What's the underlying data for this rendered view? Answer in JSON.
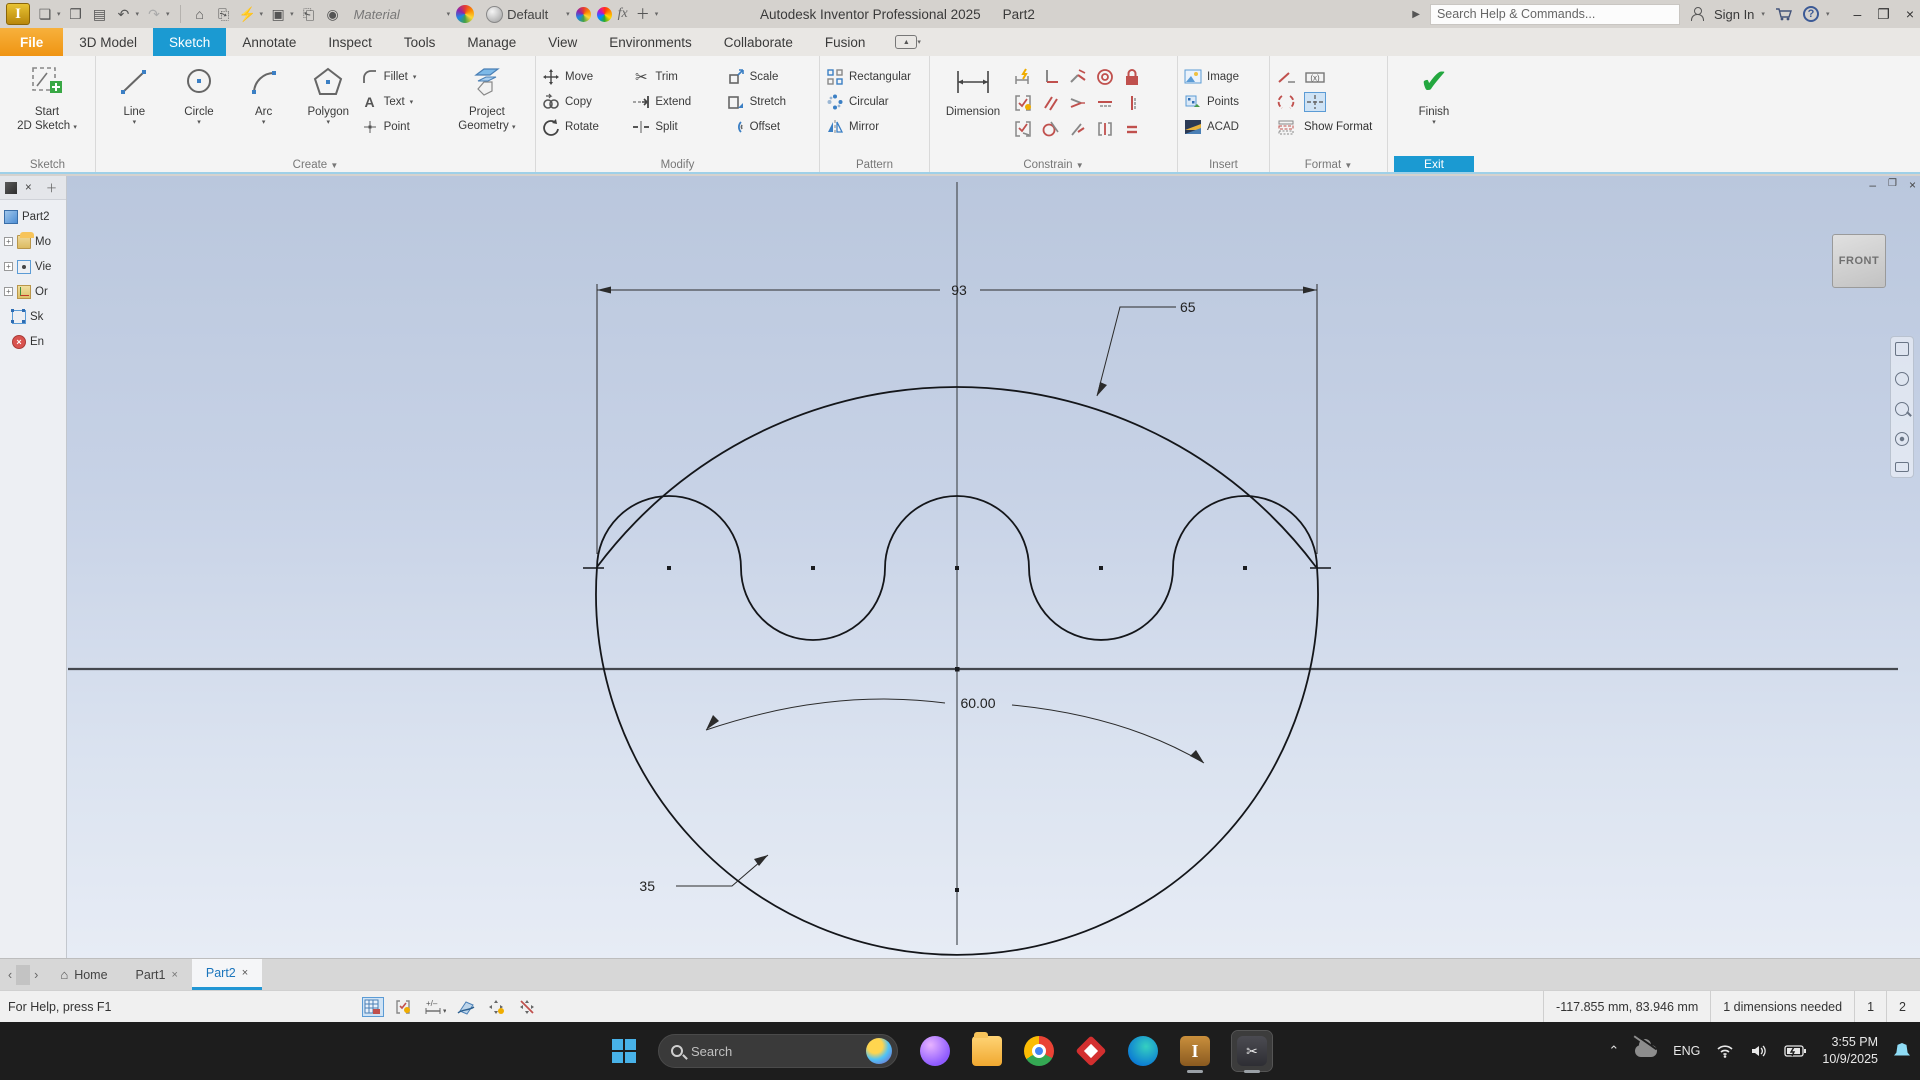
{
  "titlebar": {
    "app_initial": "I",
    "material_label": "Material",
    "appearance_label": "Default",
    "fx_label": "fx",
    "title": "Autodesk Inventor Professional 2025",
    "document": "Part2",
    "search_placeholder": "Search Help & Commands...",
    "sign_in_label": "Sign In",
    "help_glyph": "?",
    "minimize_glyph": "–",
    "restore_glyph": "❐",
    "close_glyph": "×"
  },
  "tabs": {
    "items": [
      {
        "label": "File"
      },
      {
        "label": "3D Model"
      },
      {
        "label": "Sketch"
      },
      {
        "label": "Annotate"
      },
      {
        "label": "Inspect"
      },
      {
        "label": "Tools"
      },
      {
        "label": "Manage"
      },
      {
        "label": "View"
      },
      {
        "label": "Environments"
      },
      {
        "label": "Collaborate"
      },
      {
        "label": "Fusion"
      }
    ]
  },
  "ribbon": {
    "sketch_panel": {
      "label": "Sketch",
      "start_line1": "Start",
      "start_line2": "2D Sketch"
    },
    "create_panel": {
      "label": "Create",
      "line": "Line",
      "circle": "Circle",
      "arc": "Arc",
      "polygon": "Polygon",
      "fillet": "Fillet",
      "text": "Text",
      "point": "Point",
      "project_line1": "Project",
      "project_line2": "Geometry"
    },
    "modify_panel": {
      "label": "Modify",
      "move": "Move",
      "copy": "Copy",
      "rotate": "Rotate",
      "trim": "Trim",
      "extend": "Extend",
      "split": "Split",
      "scale": "Scale",
      "stretch": "Stretch",
      "offset": "Offset"
    },
    "pattern_panel": {
      "label": "Pattern",
      "rectangular": "Rectangular",
      "circular": "Circular",
      "mirror": "Mirror"
    },
    "constrain_panel": {
      "label": "Constrain",
      "dimension": "Dimension"
    },
    "insert_panel": {
      "label": "Insert",
      "image": "Image",
      "points": "Points",
      "acad": "ACAD"
    },
    "format_panel": {
      "label": "Format",
      "show_format": "Show Format"
    },
    "exit_panel": {
      "label": "Exit",
      "finish": "Finish",
      "check_glyph": "✔"
    }
  },
  "browser": {
    "doc": "Part2",
    "items": [
      {
        "label": "Mo"
      },
      {
        "label": "Vie"
      },
      {
        "label": "Or"
      },
      {
        "label": "Sk"
      },
      {
        "label": "En"
      }
    ]
  },
  "canvas": {
    "viewcube_face": "FRONT",
    "dim_width": "93",
    "dim_radius": "65",
    "dim_arc": "60.00",
    "dim_leader": "35"
  },
  "doctabs": {
    "home": "Home",
    "part1": "Part1",
    "part2": "Part2",
    "close_glyph": "×"
  },
  "status": {
    "help": "For Help, press F1",
    "coords": "-117.855 mm, 83.946 mm",
    "dims_needed": "1 dimensions needed",
    "count1": "1",
    "count2": "2"
  },
  "taskbar": {
    "search_placeholder": "Search",
    "lang": "ENG",
    "time": "3:55 PM",
    "date": "10/9/2025",
    "inventor_initial": "I",
    "snip_glyph": "✂"
  }
}
